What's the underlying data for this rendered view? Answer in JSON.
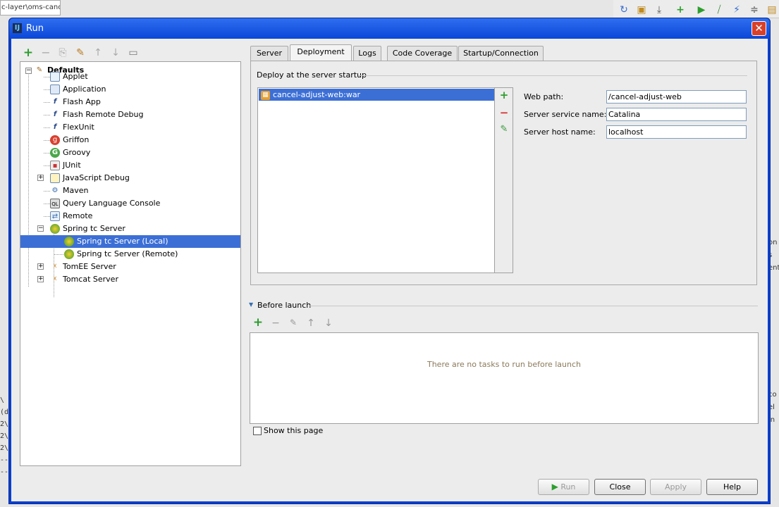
{
  "background": {
    "editor_tab": "c-layer\\oms-cance",
    "console_lines": [
      "\\(d",
      "2\\",
      "2\\",
      "2\\",
      "----",
      "----",
      "20"
    ],
    "right_fragments": [
      "on",
      "s",
      "ent",
      "",
      "",
      "",
      "",
      "",
      "",
      "",
      "",
      "",
      "co",
      "el",
      "in"
    ]
  },
  "window": {
    "title": "Run",
    "close_symbol": "✕"
  },
  "left_toolbar": {
    "add": "+",
    "remove": "−",
    "copy": "⎘",
    "edit_defaults": "✎",
    "move_up": "↑",
    "move_down": "↓",
    "folder": "▭"
  },
  "tree": {
    "root": "Defaults",
    "items": [
      {
        "label": "Applet",
        "icon": "applet-icon"
      },
      {
        "label": "Application",
        "icon": "application-icon"
      },
      {
        "label": "Flash App",
        "icon": "flash-icon"
      },
      {
        "label": "Flash Remote Debug",
        "icon": "flash-debug-icon"
      },
      {
        "label": "FlexUnit",
        "icon": "flexunit-icon"
      },
      {
        "label": "Griffon",
        "icon": "griffon-icon"
      },
      {
        "label": "Groovy",
        "icon": "groovy-icon"
      },
      {
        "label": "JUnit",
        "icon": "junit-icon"
      },
      {
        "label": "JavaScript Debug",
        "icon": "javascript-debug-icon"
      },
      {
        "label": "Maven",
        "icon": "maven-icon"
      },
      {
        "label": "Query Language Console",
        "icon": "query-console-icon"
      },
      {
        "label": "Remote",
        "icon": "remote-icon"
      },
      {
        "label": "Spring tc Server",
        "icon": "spring-icon"
      },
      {
        "label": "Spring tc Server (Local)",
        "icon": "spring-icon"
      },
      {
        "label": "Spring tc Server (Remote)",
        "icon": "spring-icon"
      },
      {
        "label": "TomEE Server",
        "icon": "tomee-icon"
      },
      {
        "label": "Tomcat Server",
        "icon": "tomcat-icon"
      }
    ]
  },
  "tabs": [
    "Server",
    "Deployment",
    "Logs",
    "Code Coverage",
    "Startup/Connection"
  ],
  "active_tab": "Deployment",
  "deployment": {
    "section_title": "Deploy at the server startup",
    "artifacts": [
      "cancel-adjust-web:war"
    ],
    "add_symbol": "+",
    "remove_symbol": "−",
    "edit_symbol": "✎",
    "fields": [
      {
        "label": "Web path:",
        "value": "/cancel-adjust-web"
      },
      {
        "label": "Server service name:",
        "value": "Catalina"
      },
      {
        "label": "Server host name:",
        "value": "localhost"
      }
    ]
  },
  "before_launch": {
    "title": "Before launch",
    "empty_text": "There are no tasks to run before launch",
    "add": "+",
    "remove": "−",
    "edit": "✎",
    "up": "↑",
    "down": "↓"
  },
  "show_this_page": "Show this page",
  "buttons": {
    "run": "Run",
    "close": "Close",
    "apply": "Apply",
    "help": "Help"
  },
  "colors": {
    "title_bar": "#2f6ff0",
    "selection": "#3c6fd6",
    "add_green": "#2d9e2d",
    "remove_red": "#d43030",
    "empty_text": "#8a7a5a"
  }
}
